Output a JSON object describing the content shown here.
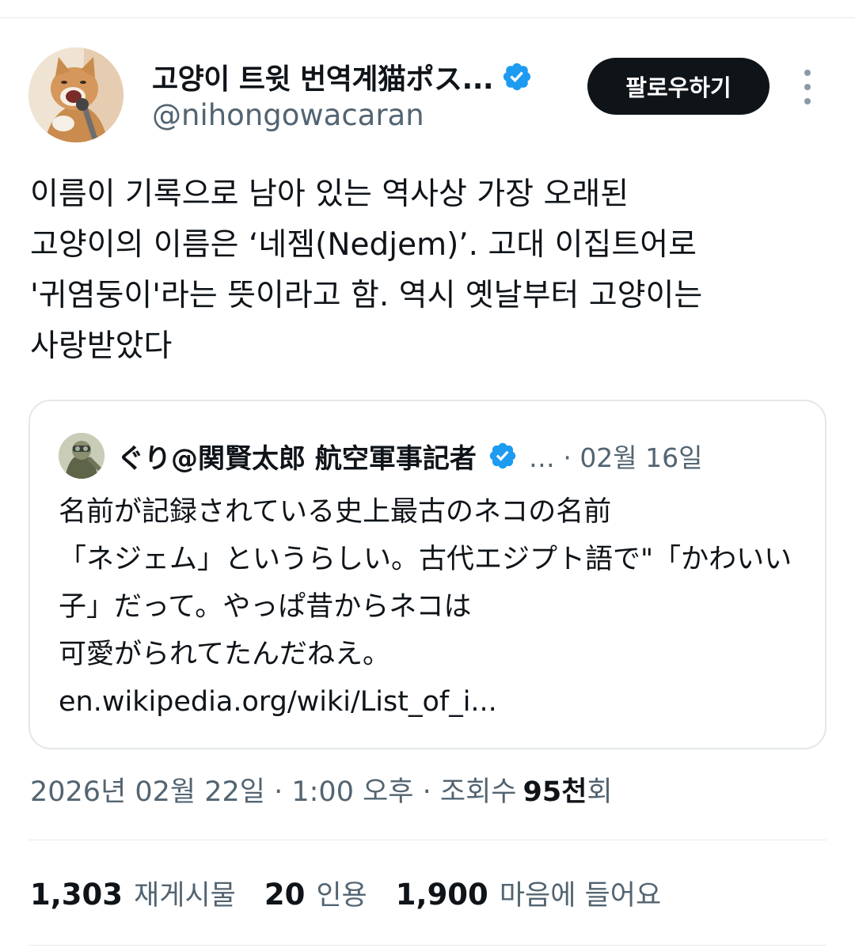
{
  "author": {
    "display_name": "고양이 트윗 번역계猫ポス...",
    "handle": "@nihongowacaran",
    "verified": true,
    "avatar": "cat-singing-avatar"
  },
  "follow_button_label": "팔로우하기",
  "more_icon": "more-vertical-icon",
  "tweet_text_lines": [
    "이름이 기록으로 남아 있는 역사상 가장 오래된",
    "고양이의 이름은 ‘네젬(Nedjem)’. 고대 이집트어로",
    "'귀염둥이'라는 뜻이라고 함. 역시 옛날부터 고양이는",
    "사랑받았다"
  ],
  "quote": {
    "author_name": "ぐり@関賢太郎 航空軍事記者",
    "verified": true,
    "meta": "… · 02월 16일",
    "text_lines": [
      "名前が記録されている史上最古のネコの名前",
      "「ネジェム」というらしい。古代エジプト語で\"「かわいい",
      "子」だって。やっぱ昔からネコは",
      "可愛がられてたんだねえ。",
      "en.wikipedia.org/wiki/List_of_i..."
    ]
  },
  "timestamp": {
    "text": "2026년 02월 22일 · 1:00 오후 · 조회수",
    "views_number": "95천",
    "views_suffix": "회"
  },
  "stats": {
    "reposts_count": "1,303",
    "reposts_label": "재게시물",
    "quotes_count": "20",
    "quotes_label": "인용",
    "likes_count": "1,900",
    "likes_label": "마음에 들어요"
  },
  "colors": {
    "text_primary": "#0f1419",
    "text_secondary": "#536471",
    "verified_blue": "#1d9bf0",
    "divider": "#e6e9ec"
  }
}
